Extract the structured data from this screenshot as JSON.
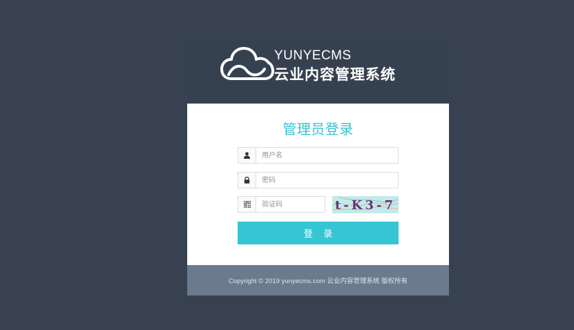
{
  "brand": {
    "name_en": "YUNYECMS",
    "name_cn": "云业内容管理系统",
    "logo_icon": "cloud-icon"
  },
  "login": {
    "title": "管理员登录",
    "username": {
      "value": "",
      "placeholder": "用户名",
      "icon": "user-icon"
    },
    "password": {
      "value": "",
      "placeholder": "密码",
      "icon": "lock-icon"
    },
    "captcha": {
      "value": "",
      "placeholder": "验证码",
      "icon": "qrcode-icon",
      "image_text": "t-K3-7"
    },
    "submit_label": "登 录"
  },
  "footer": {
    "copyright": "Copyright © 2019 yunyecms.com 云业内容管理系统 版权所有"
  },
  "colors": {
    "background": "#37414f",
    "accent": "#36c6d3",
    "title": "#36c3d1",
    "footer_bg": "#6c7a8d"
  }
}
